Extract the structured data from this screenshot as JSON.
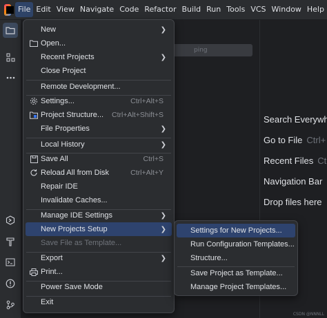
{
  "menubar": {
    "items": [
      "File",
      "Edit",
      "View",
      "Navigate",
      "Code",
      "Refactor",
      "Build",
      "Run",
      "Tools",
      "VCS",
      "Window",
      "Help"
    ]
  },
  "editor": {
    "search_placeholder": "ping",
    "tips": [
      {
        "label": "Search Everywh",
        "key": ""
      },
      {
        "label": "Go to File",
        "key": "Ctrl+"
      },
      {
        "label": "Recent Files",
        "key": "Ct"
      },
      {
        "label": "Navigation Bar",
        "key": ""
      },
      {
        "label": "Drop files here",
        "key": ""
      }
    ],
    "watermark": "CSDN @NNNLL"
  },
  "file_menu": {
    "items": [
      {
        "label": "New",
        "shortcut": "",
        "submenu": true,
        "icon": ""
      },
      {
        "label": "Open...",
        "shortcut": "",
        "submenu": false,
        "icon": "folder-icon"
      },
      {
        "label": "Recent Projects",
        "shortcut": "",
        "submenu": true,
        "icon": ""
      },
      {
        "label": "Close Project",
        "shortcut": "",
        "submenu": false,
        "icon": ""
      },
      {
        "label": "Remote Development...",
        "shortcut": "",
        "submenu": false,
        "icon": ""
      },
      {
        "label": "Settings...",
        "shortcut": "Ctrl+Alt+S",
        "submenu": false,
        "icon": "gear-icon"
      },
      {
        "label": "Project Structure...",
        "shortcut": "Ctrl+Alt+Shift+S",
        "submenu": false,
        "icon": "project-structure-icon"
      },
      {
        "label": "File Properties",
        "shortcut": "",
        "submenu": true,
        "icon": ""
      },
      {
        "label": "Local History",
        "shortcut": "",
        "submenu": true,
        "icon": ""
      },
      {
        "label": "Save All",
        "shortcut": "Ctrl+S",
        "submenu": false,
        "icon": "save-icon"
      },
      {
        "label": "Reload All from Disk",
        "shortcut": "Ctrl+Alt+Y",
        "submenu": false,
        "icon": "reload-icon"
      },
      {
        "label": "Repair IDE",
        "shortcut": "",
        "submenu": false,
        "icon": ""
      },
      {
        "label": "Invalidate Caches...",
        "shortcut": "",
        "submenu": false,
        "icon": ""
      },
      {
        "label": "Manage IDE Settings",
        "shortcut": "",
        "submenu": true,
        "icon": ""
      },
      {
        "label": "New Projects Setup",
        "shortcut": "",
        "submenu": true,
        "icon": ""
      },
      {
        "label": "Save File as Template...",
        "shortcut": "",
        "submenu": false,
        "icon": ""
      },
      {
        "label": "Export",
        "shortcut": "",
        "submenu": true,
        "icon": ""
      },
      {
        "label": "Print...",
        "shortcut": "",
        "submenu": false,
        "icon": "print-icon"
      },
      {
        "label": "Power Save Mode",
        "shortcut": "",
        "submenu": false,
        "icon": ""
      },
      {
        "label": "Exit",
        "shortcut": "",
        "submenu": false,
        "icon": ""
      }
    ]
  },
  "sub_menu": {
    "items": [
      {
        "label": "Settings for New Projects..."
      },
      {
        "label": "Run Configuration Templates..."
      },
      {
        "label": "Structure..."
      },
      {
        "label": "Save Project as Template..."
      },
      {
        "label": "Manage Project Templates..."
      }
    ]
  },
  "colors": {
    "highlight": "#2e436e",
    "menu_bg": "#2b2d30",
    "editor_bg": "#1e1f22"
  }
}
